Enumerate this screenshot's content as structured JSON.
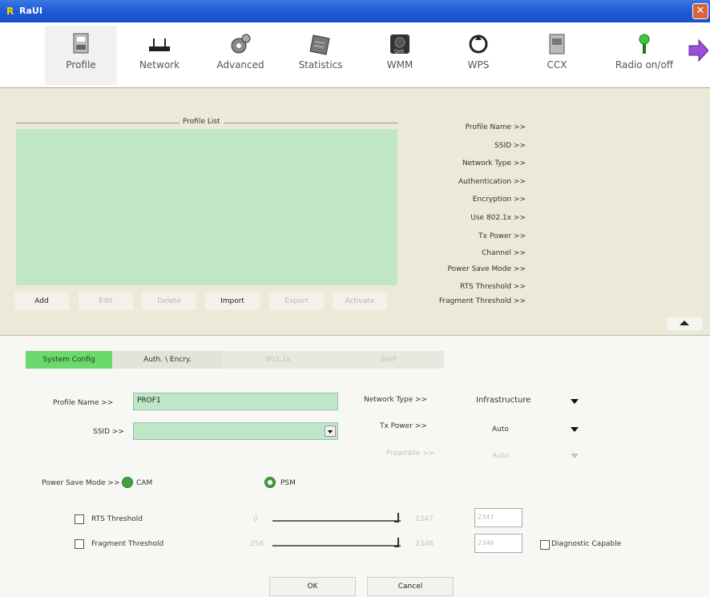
{
  "window": {
    "title": "RaUI",
    "close_glyph": "✕"
  },
  "toolbar": {
    "items": [
      {
        "label": "Profile",
        "icon": "profile-icon",
        "active": true
      },
      {
        "label": "Network",
        "icon": "network-icon"
      },
      {
        "label": "Advanced",
        "icon": "advanced-icon"
      },
      {
        "label": "Statistics",
        "icon": "statistics-icon"
      },
      {
        "label": "WMM",
        "icon": "wmm-icon"
      },
      {
        "label": "WPS",
        "icon": "wps-icon"
      },
      {
        "label": "CCX",
        "icon": "ccx-icon"
      },
      {
        "label": "Radio on/off",
        "icon": "radio-icon"
      }
    ]
  },
  "profile_list": {
    "title": "Profile List",
    "buttons": {
      "add": "Add",
      "edit": "Edit",
      "delete": "Delete",
      "import": "Import",
      "export": "Export",
      "activate": "Activate"
    }
  },
  "details": {
    "profile_name": "Profile Name >>",
    "ssid": "SSID >>",
    "network_type": "Network Type >>",
    "authentication": "Authentication >>",
    "encryption": "Encryption >>",
    "use8021x": "Use 802.1x >>",
    "txpower": "Tx Power >>",
    "channel": "Channel >>",
    "power_save_mode": "Power Save Mode >>",
    "rts_threshold": "RTS Threshold >>",
    "frag_threshold": "Fragment Threshold >>"
  },
  "tabs": {
    "system_config": "System Config",
    "auth_encry": "Auth. \\ Encry.",
    "8021x": "802.1x",
    "wap": "WAP"
  },
  "form": {
    "profile_name_label": "Profile Name >>",
    "profile_name_value": "PROF1",
    "ssid_label": "SSID >>",
    "ssid_value": "",
    "network_type_label": "Network Type >>",
    "network_type_value": "Infrastructure",
    "txpower_label": "Tx Power >>",
    "txpower_value": "Auto",
    "preamble_label": "Preamble >>",
    "preamble_value": "Auto",
    "power_save_label": "Power Save Mode >>",
    "cam_label": "CAM",
    "psm_label": "PSM",
    "rts_label": "RTS Threshold",
    "rts_min": "0",
    "rts_max": "2347",
    "rts_value": "2347",
    "frag_label": "Fragment Threshold",
    "frag_min": "256",
    "frag_max": "2346",
    "frag_value": "2346",
    "diagnostic_label": "Diagnostic Capable"
  },
  "footer": {
    "ok": "OK",
    "cancel": "Cancel"
  },
  "colors": {
    "accent_green": "#6bd86b",
    "list_green": "#bfe7c6",
    "title_blue": "#1f5ad6"
  }
}
